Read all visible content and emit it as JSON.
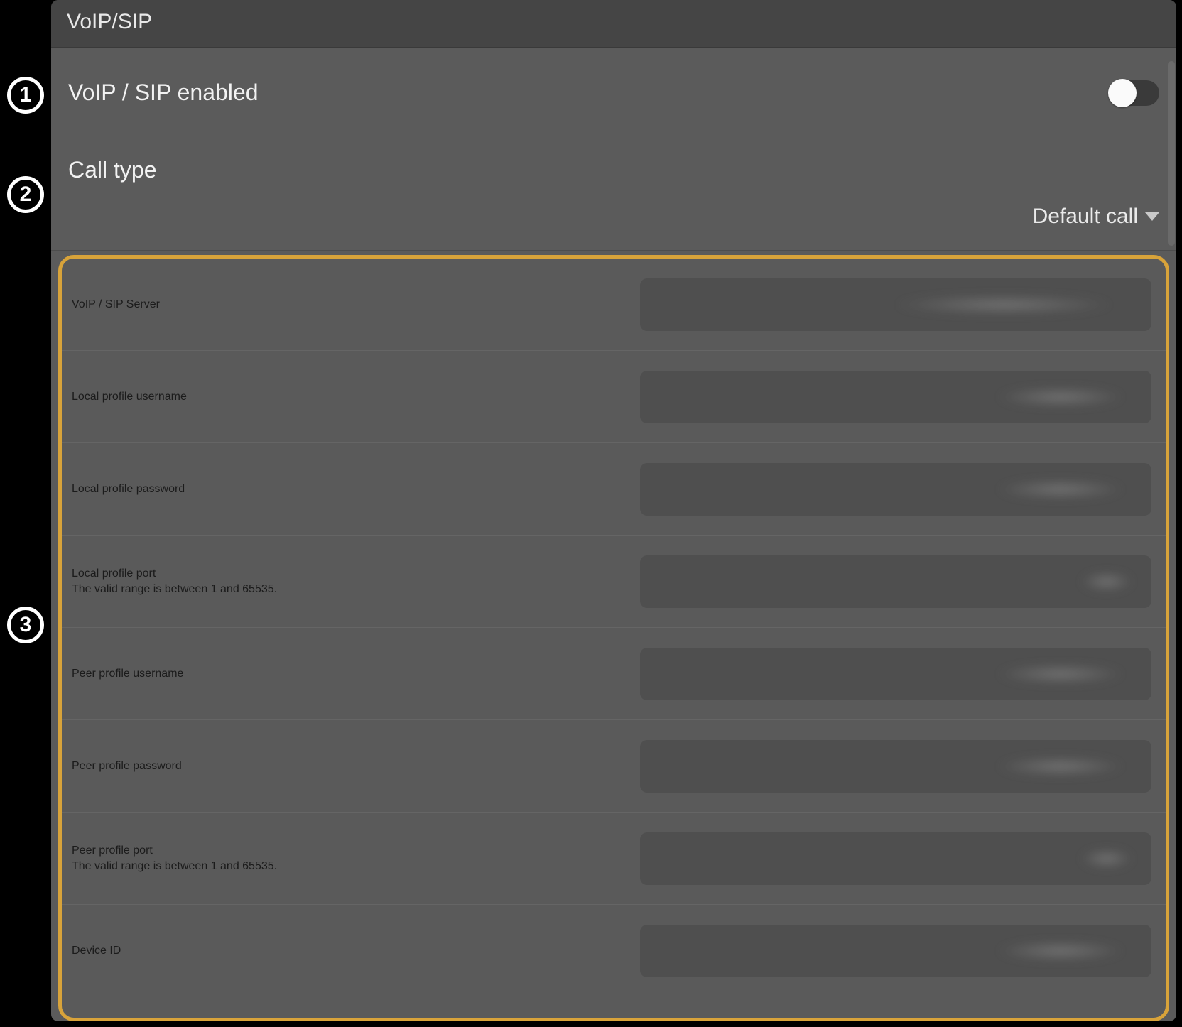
{
  "header": {
    "title": "VoIP/SIP"
  },
  "badges": {
    "one": "1",
    "two": "2",
    "three": "3"
  },
  "rows": {
    "enabled": {
      "title": "VoIP / SIP enabled",
      "state": "off"
    },
    "callType": {
      "title": "Call type",
      "value": "Default call"
    }
  },
  "fields": [
    {
      "title": "VoIP / SIP Server",
      "subtitle": "",
      "blur": "wide"
    },
    {
      "title": "Local profile username",
      "subtitle": "",
      "blur": ""
    },
    {
      "title": "Local profile password",
      "subtitle": "",
      "blur": ""
    },
    {
      "title": "Local profile port",
      "subtitle": "The valid range is between 1 and 65535.",
      "blur": "short"
    },
    {
      "title": "Peer profile username",
      "subtitle": "",
      "blur": ""
    },
    {
      "title": "Peer profile password",
      "subtitle": "",
      "blur": ""
    },
    {
      "title": "Peer profile port",
      "subtitle": "The valid range is between 1 and 65535.",
      "blur": "short"
    },
    {
      "title": "Device ID",
      "subtitle": "",
      "blur": ""
    }
  ]
}
